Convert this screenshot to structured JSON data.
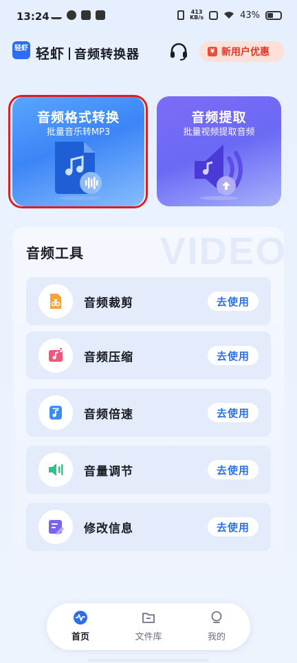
{
  "status_bar": {
    "time": "13:24",
    "net_speed_value": "413",
    "net_speed_unit": "KB/s",
    "battery": "43%"
  },
  "header": {
    "logo_text": "轻虾",
    "brand": "轻虾",
    "subtitle": "音频转换器",
    "promo_label": "新用户优惠",
    "promo_icon": "¥"
  },
  "features": [
    {
      "title": "音频格式转换",
      "subtitle": "批量音乐转MP3",
      "icon": "music-file-icon"
    },
    {
      "title": "音频提取",
      "subtitle": "批量视频提取音频",
      "icon": "speaker-extract-icon"
    }
  ],
  "tools": {
    "title": "音频工具",
    "watermark": "VIDEO",
    "items": [
      {
        "label": "音频裁剪",
        "button": "去使用",
        "icon": "scissors-icon",
        "color": "#f6a33a"
      },
      {
        "label": "音频压缩",
        "button": "去使用",
        "icon": "compress-icon",
        "color": "#f2577a"
      },
      {
        "label": "音频倍速",
        "button": "去使用",
        "icon": "speed-icon",
        "color": "#3c8cf5"
      },
      {
        "label": "音量调节",
        "button": "去使用",
        "icon": "volume-icon",
        "color": "#2fc28a"
      },
      {
        "label": "修改信息",
        "button": "去使用",
        "icon": "edit-info-icon",
        "color": "#7b63f0"
      }
    ]
  },
  "nav": [
    {
      "label": "首页",
      "icon": "home-wave-icon",
      "active": true
    },
    {
      "label": "文件库",
      "icon": "folder-icon",
      "active": false
    },
    {
      "label": "我的",
      "icon": "profile-icon",
      "active": false
    }
  ],
  "colors": {
    "accent": "#2d6fe8",
    "promo": "#e1362a",
    "highlight": "#d81f25"
  }
}
